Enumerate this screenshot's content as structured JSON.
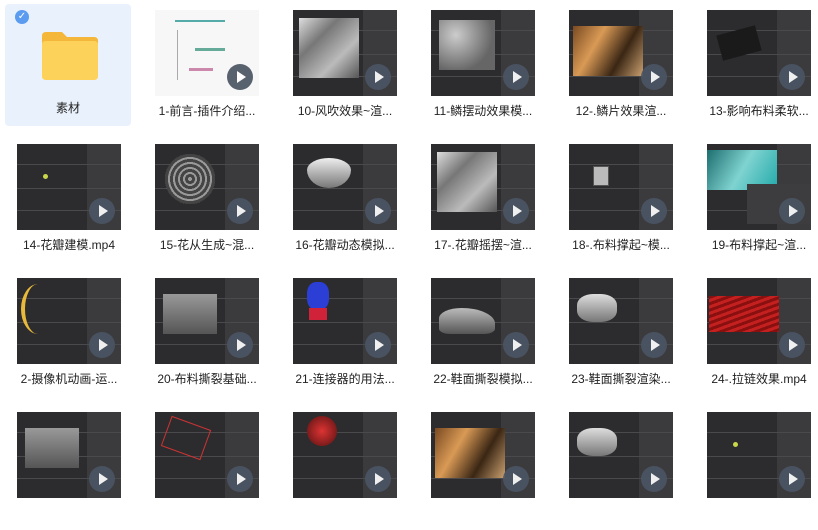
{
  "folder": {
    "name": "素材",
    "icon": "folder-icon",
    "selected_icon": "check-icon"
  },
  "videos": [
    {
      "label": "1-前言-插件介绍...",
      "style": "light"
    },
    {
      "label": "10-风吹效果~渲...",
      "style": "cloth"
    },
    {
      "label": "11-鳞摆动效果模...",
      "style": "scales"
    },
    {
      "label": "12-.鳞片效果渲...",
      "style": "render"
    },
    {
      "label": "13-影响布料柔软...",
      "style": "dark"
    },
    {
      "label": "14-花瓣建模.mp4",
      "style": "ui"
    },
    {
      "label": "15-花从生成~混...",
      "style": "spiral"
    },
    {
      "label": "16-花瓣动态模拟...",
      "style": "bowl"
    },
    {
      "label": "17-.花瓣摇摆~渲...",
      "style": "cloth"
    },
    {
      "label": "18-.布料撑起~模...",
      "style": "box"
    },
    {
      "label": "19-布料撑起~渲...",
      "style": "teal"
    },
    {
      "label": "2-摄像机动画-运...",
      "style": "yellow"
    },
    {
      "label": "20-布料撕裂基础...",
      "style": "plane"
    },
    {
      "label": "21-连接器的用法...",
      "style": "blue"
    },
    {
      "label": "22-鞋面撕裂模拟...",
      "style": "shoe"
    },
    {
      "label": "23-鞋面撕裂渲染...",
      "style": "shoe2"
    },
    {
      "label": "24-.拉链效果.mp4",
      "style": "red"
    },
    {
      "label": "",
      "style": "plane"
    },
    {
      "label": "",
      "style": "redlines"
    },
    {
      "label": "",
      "style": "redtree"
    },
    {
      "label": "",
      "style": "render"
    },
    {
      "label": "",
      "style": "shoe2"
    },
    {
      "label": "",
      "style": "ui"
    }
  ],
  "colors": {
    "folder_bg": "#e9f1fc",
    "accent": "#5b9cf0",
    "thumb_bg": "#2c2c2e",
    "play_bg": "#4b5563"
  }
}
